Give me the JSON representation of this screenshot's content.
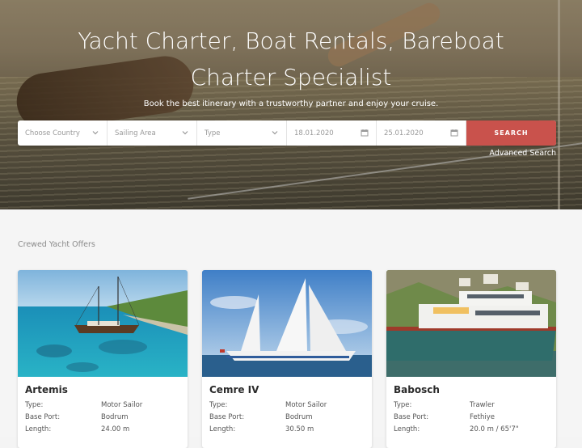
{
  "hero": {
    "title_line1": "Yacht Charter, Boat Rentals, Bareboat",
    "title_line2": "Charter Specialist",
    "subtitle": "Book the best itinerary with a trustworthy partner and enjoy your cruise."
  },
  "search": {
    "country_placeholder": "Choose Country",
    "area_placeholder": "Sailing Area",
    "type_placeholder": "Type",
    "date_from": "18.01.2020",
    "date_to": "25.01.2020",
    "button_label": "SEARCH",
    "advanced_link": "Advanced Search"
  },
  "offers": {
    "section_title": "Crewed Yacht Offers",
    "cards": [
      {
        "name": "Artemis",
        "type_label": "Type:",
        "type": "Motor Sailor",
        "port_label": "Base Port:",
        "port": "Bodrum",
        "length_label": "Length:",
        "length": "24.00 m"
      },
      {
        "name": "Cemre IV",
        "type_label": "Type:",
        "type": "Motor Sailor",
        "port_label": "Base Port:",
        "port": "Bodrum",
        "length_label": "Length:",
        "length": "30.50 m"
      },
      {
        "name": "Babosch",
        "type_label": "Type:",
        "type": "Trawler",
        "port_label": "Base Port:",
        "port": "Fethiye",
        "length_label": "Length:",
        "length": "20.0 m / 65'7\""
      }
    ]
  },
  "colors": {
    "search_button": "#c9524c",
    "card_bg": "#ffffff",
    "page_bg": "#f5f5f5"
  },
  "icons": [
    "chevron-down-icon",
    "calendar-icon"
  ]
}
